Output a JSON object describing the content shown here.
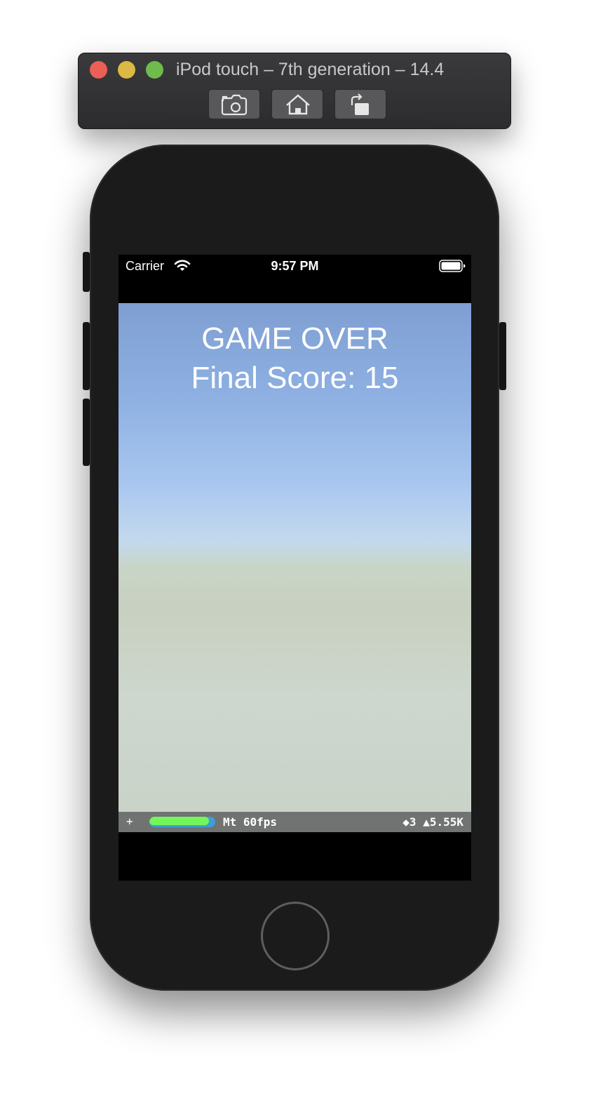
{
  "simulator": {
    "title": "iPod touch – 7th generation – 14.4",
    "toolbar": {
      "screenshot_icon": "camera-icon",
      "home_icon": "home-icon",
      "rotate_icon": "rotate-icon"
    },
    "traffic_lights": {
      "close_color": "#ec5f57",
      "minimize_color": "#dcb942",
      "zoom_color": "#6fbb4c"
    }
  },
  "status_bar": {
    "carrier": "Carrier",
    "time": "9:57 PM",
    "wifi_icon": "wifi-icon",
    "battery_icon": "battery-icon"
  },
  "game": {
    "title": "GAME OVER",
    "score_text": "Final Score: 15"
  },
  "stats_overlay": {
    "expand": "+",
    "fps_text": "Mt 60fps",
    "meter_fill_fraction": 0.9,
    "meter_color": "#74f55a",
    "stats_text": "◆3 ▲5.55K"
  }
}
